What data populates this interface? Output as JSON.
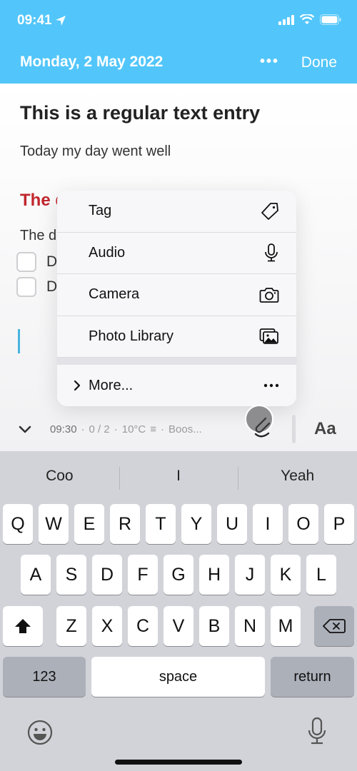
{
  "status_bar": {
    "time": "09:41",
    "icons": [
      "location-arrow-icon",
      "signal-icon",
      "wifi-icon",
      "battery-icon"
    ]
  },
  "header": {
    "date": "Monday, 2 May 2022",
    "more_label": "•••",
    "done_label": "Done",
    "accent": "#52c6fa"
  },
  "entry": {
    "title": "This is a regular text entry",
    "body": "Today my day went well",
    "heading_partial": "The d",
    "heading_color": "#c1272d",
    "text_partial": "The d",
    "todos": [
      {
        "label": "D",
        "checked": false
      },
      {
        "label": "D",
        "checked": false
      }
    ]
  },
  "menu": {
    "items": [
      {
        "label": "Tag",
        "icon": "tag-icon"
      },
      {
        "label": "Audio",
        "icon": "microphone-icon"
      },
      {
        "label": "Camera",
        "icon": "camera-icon"
      },
      {
        "label": "Photo Library",
        "icon": "photo-library-icon"
      }
    ],
    "more": {
      "label": "More...",
      "icon": "ellipsis-icon"
    }
  },
  "footer": {
    "time": "09:30",
    "sep": "·",
    "progress": "0 / 2",
    "temp": "10°C",
    "location": "Boos...",
    "font_button": "Aa"
  },
  "keyboard": {
    "suggestions": [
      "Coo",
      "I",
      "Yeah"
    ],
    "row1": [
      "Q",
      "W",
      "E",
      "R",
      "T",
      "Y",
      "U",
      "I",
      "O",
      "P"
    ],
    "row2": [
      "A",
      "S",
      "D",
      "F",
      "G",
      "H",
      "J",
      "K",
      "L"
    ],
    "row3": [
      "Z",
      "X",
      "C",
      "V",
      "B",
      "N",
      "M"
    ],
    "numbers_label": "123",
    "space_label": "space",
    "return_label": "return"
  }
}
